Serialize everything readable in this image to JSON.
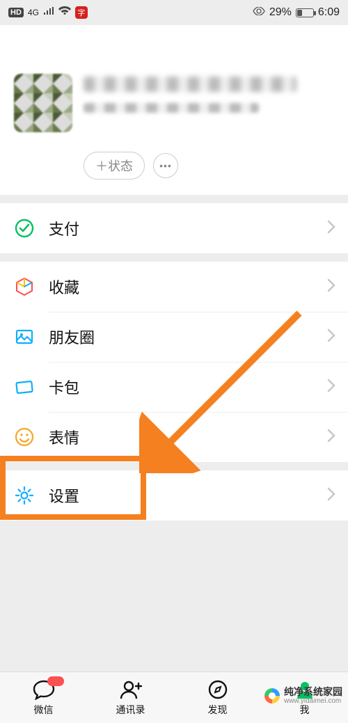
{
  "status_bar": {
    "hd": "HD",
    "net": "4G",
    "eye_icon": "eye-icon",
    "battery_percent": "29%",
    "time": "6:09"
  },
  "profile": {
    "status_button": "＋状态",
    "more_button": "•••"
  },
  "sections": [
    {
      "rows": [
        {
          "icon": "pay-icon",
          "label": "支付",
          "color": "#07c160"
        }
      ]
    },
    {
      "rows": [
        {
          "icon": "cube-icon",
          "label": "收藏",
          "color_multi": true
        },
        {
          "icon": "gallery-icon",
          "label": "朋友圈",
          "color": "#10aeff"
        },
        {
          "icon": "card-icon",
          "label": "卡包",
          "color": "#10aeff"
        },
        {
          "icon": "emoji-icon",
          "label": "表情",
          "color": "#f5a623"
        }
      ]
    },
    {
      "rows": [
        {
          "icon": "settings-icon",
          "label": "设置",
          "color": "#10aeff"
        }
      ]
    }
  ],
  "tabs": [
    {
      "icon": "chat-icon",
      "label": "微信",
      "badge": true
    },
    {
      "icon": "contacts-icon",
      "label": "通讯录"
    },
    {
      "icon": "discover-icon",
      "label": "发现"
    },
    {
      "icon": "me-icon",
      "label": "我",
      "active": true
    }
  ],
  "watermark": {
    "title": "纯净系统家园",
    "url": "www.yidaimei.com"
  }
}
